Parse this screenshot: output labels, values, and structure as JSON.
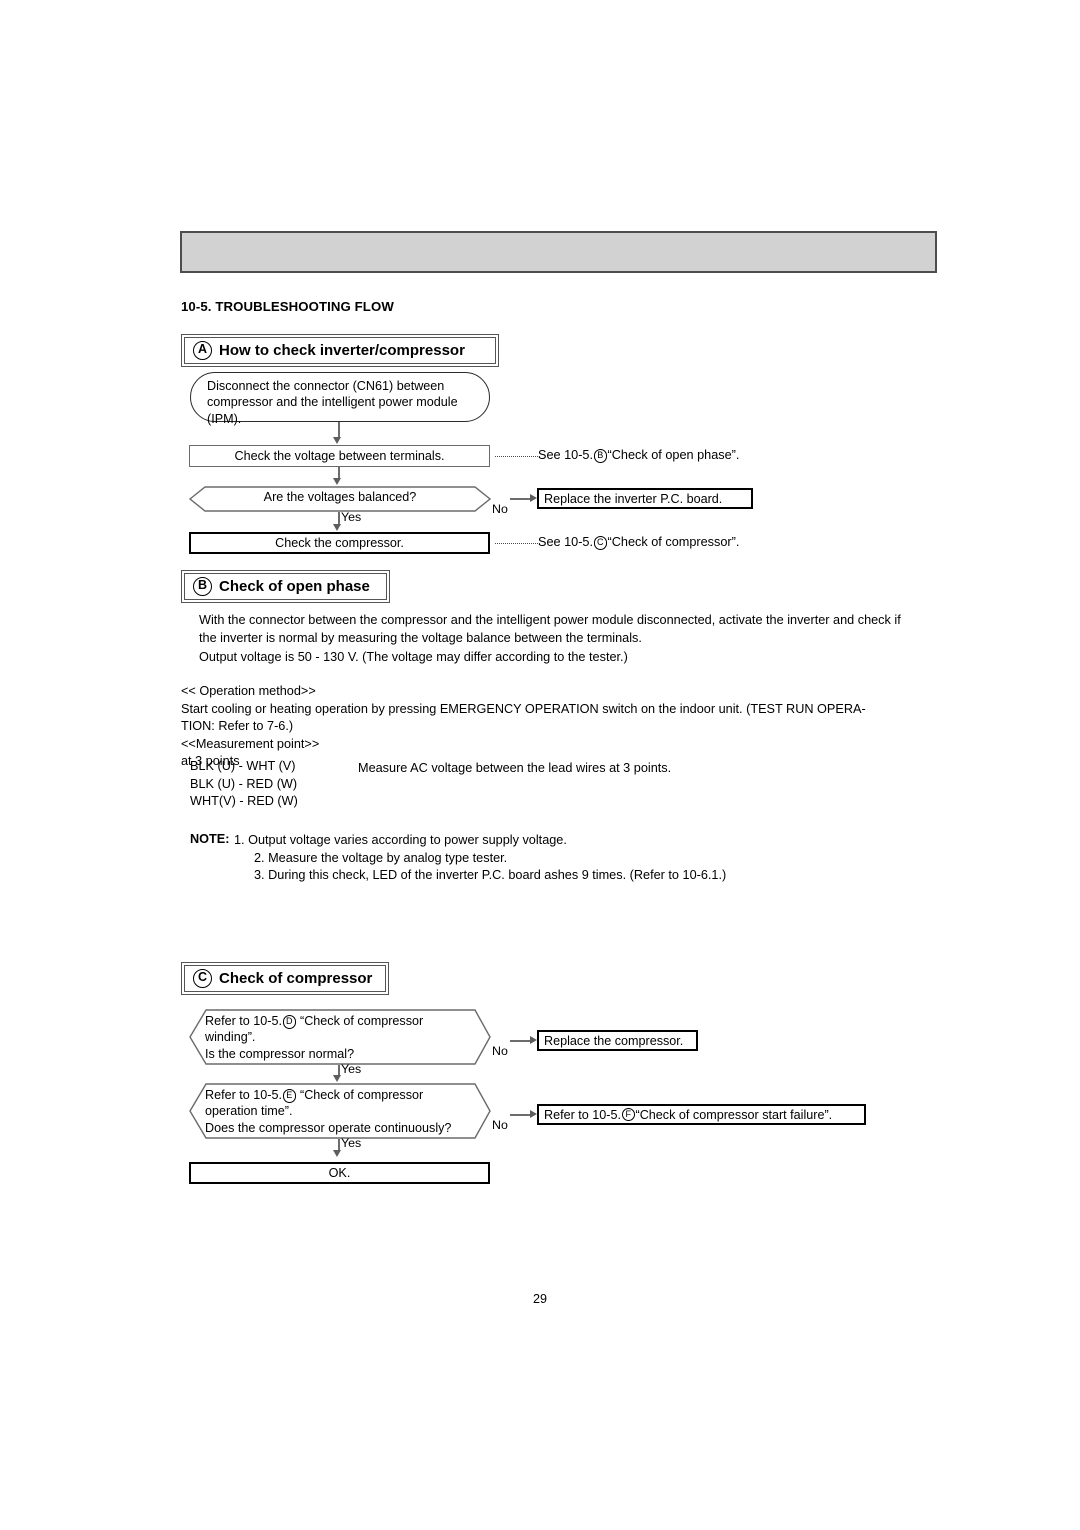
{
  "document": {
    "page_number": "29",
    "section_heading": "10-5. TROUBLESHOOTING FLOW"
  },
  "header_bar": {
    "label": "",
    "fill_color": "#d2d2d2",
    "border_color": "#4d4d4d"
  },
  "section_a": {
    "letter": "A",
    "title": "How to check inverter/compressor",
    "nodes": {
      "disconnect": "Disconnect the connector (CN61) between compressor and the intelligent power module (IPM).",
      "check_voltage": "Check the voltage between terminals.",
      "decision_balanced": "Are the voltages balanced?",
      "replace_pcb": "Replace the inverter P.C. board.",
      "check_compressor": "Check the compressor."
    },
    "branches": {
      "balanced_yes": "Yes",
      "balanced_no": "No"
    },
    "references": {
      "see_open_phase_pre": "See 10-5.",
      "see_open_phase_letter": "B",
      "see_open_phase_post": "“Check of open phase”.",
      "see_compressor_pre": "See 10-5.",
      "see_compressor_letter": "C",
      "see_compressor_post": "“Check of compressor”."
    }
  },
  "section_b": {
    "letter": "B",
    "title": "Check of open phase",
    "intro": "With the connector between the compressor and the intelligent power module disconnected, activate the inverter and check if\nthe inverter is normal by measuring the voltage balance between the terminals.",
    "output_voltage": "Output voltage is 50 - 130 V. (The voltage may differ according to the tester.)",
    "operation_method": "<< Operation method>>\n  Start cooling or heating operation by pressing EMERGENCY OPERATION switch on the indoor unit. (TEST RUN OPERA-\n  TION: Refer to 7-6.)\n<<Measurement point>>\n  at 3 points",
    "measurement_points": "BLK (U) - WHT (V)\nBLK (U) - RED (W)\nWHT(V) - RED (W)",
    "measurement_note": "Measure AC voltage between the lead wires at 3 points.",
    "note_label": "NOTE:",
    "notes": [
      "1. Output voltage varies according to power supply voltage.",
      "2. Measure the voltage by analog type tester.",
      "3. During this check, LED of the inverter P.C. board  ashes 9 times. (Refer to 10-6.1.)"
    ]
  },
  "section_c": {
    "letter": "C",
    "title": "Check of compressor",
    "nodes": {
      "decision_winding_pre": "Refer to 10-5.",
      "decision_winding_letter": "D",
      "decision_winding_post": " “Check of compressor\nwinding”.\nIs the compressor normal?",
      "replace_compressor": "Replace the compressor.",
      "decision_optime_pre": "Refer to 10-5.",
      "decision_optime_letter": "E",
      "decision_optime_post": " “Check of compressor\noperation time”.\nDoes the compressor operate continuously?",
      "refer_f_pre": "Refer to 10-5.",
      "refer_f_letter": "F",
      "refer_f_post": " “Check of compressor start failure”.",
      "ok": "OK."
    },
    "branches": {
      "winding_yes": "Yes",
      "winding_no": "No",
      "optime_yes": "Yes",
      "optime_no": "No"
    }
  }
}
